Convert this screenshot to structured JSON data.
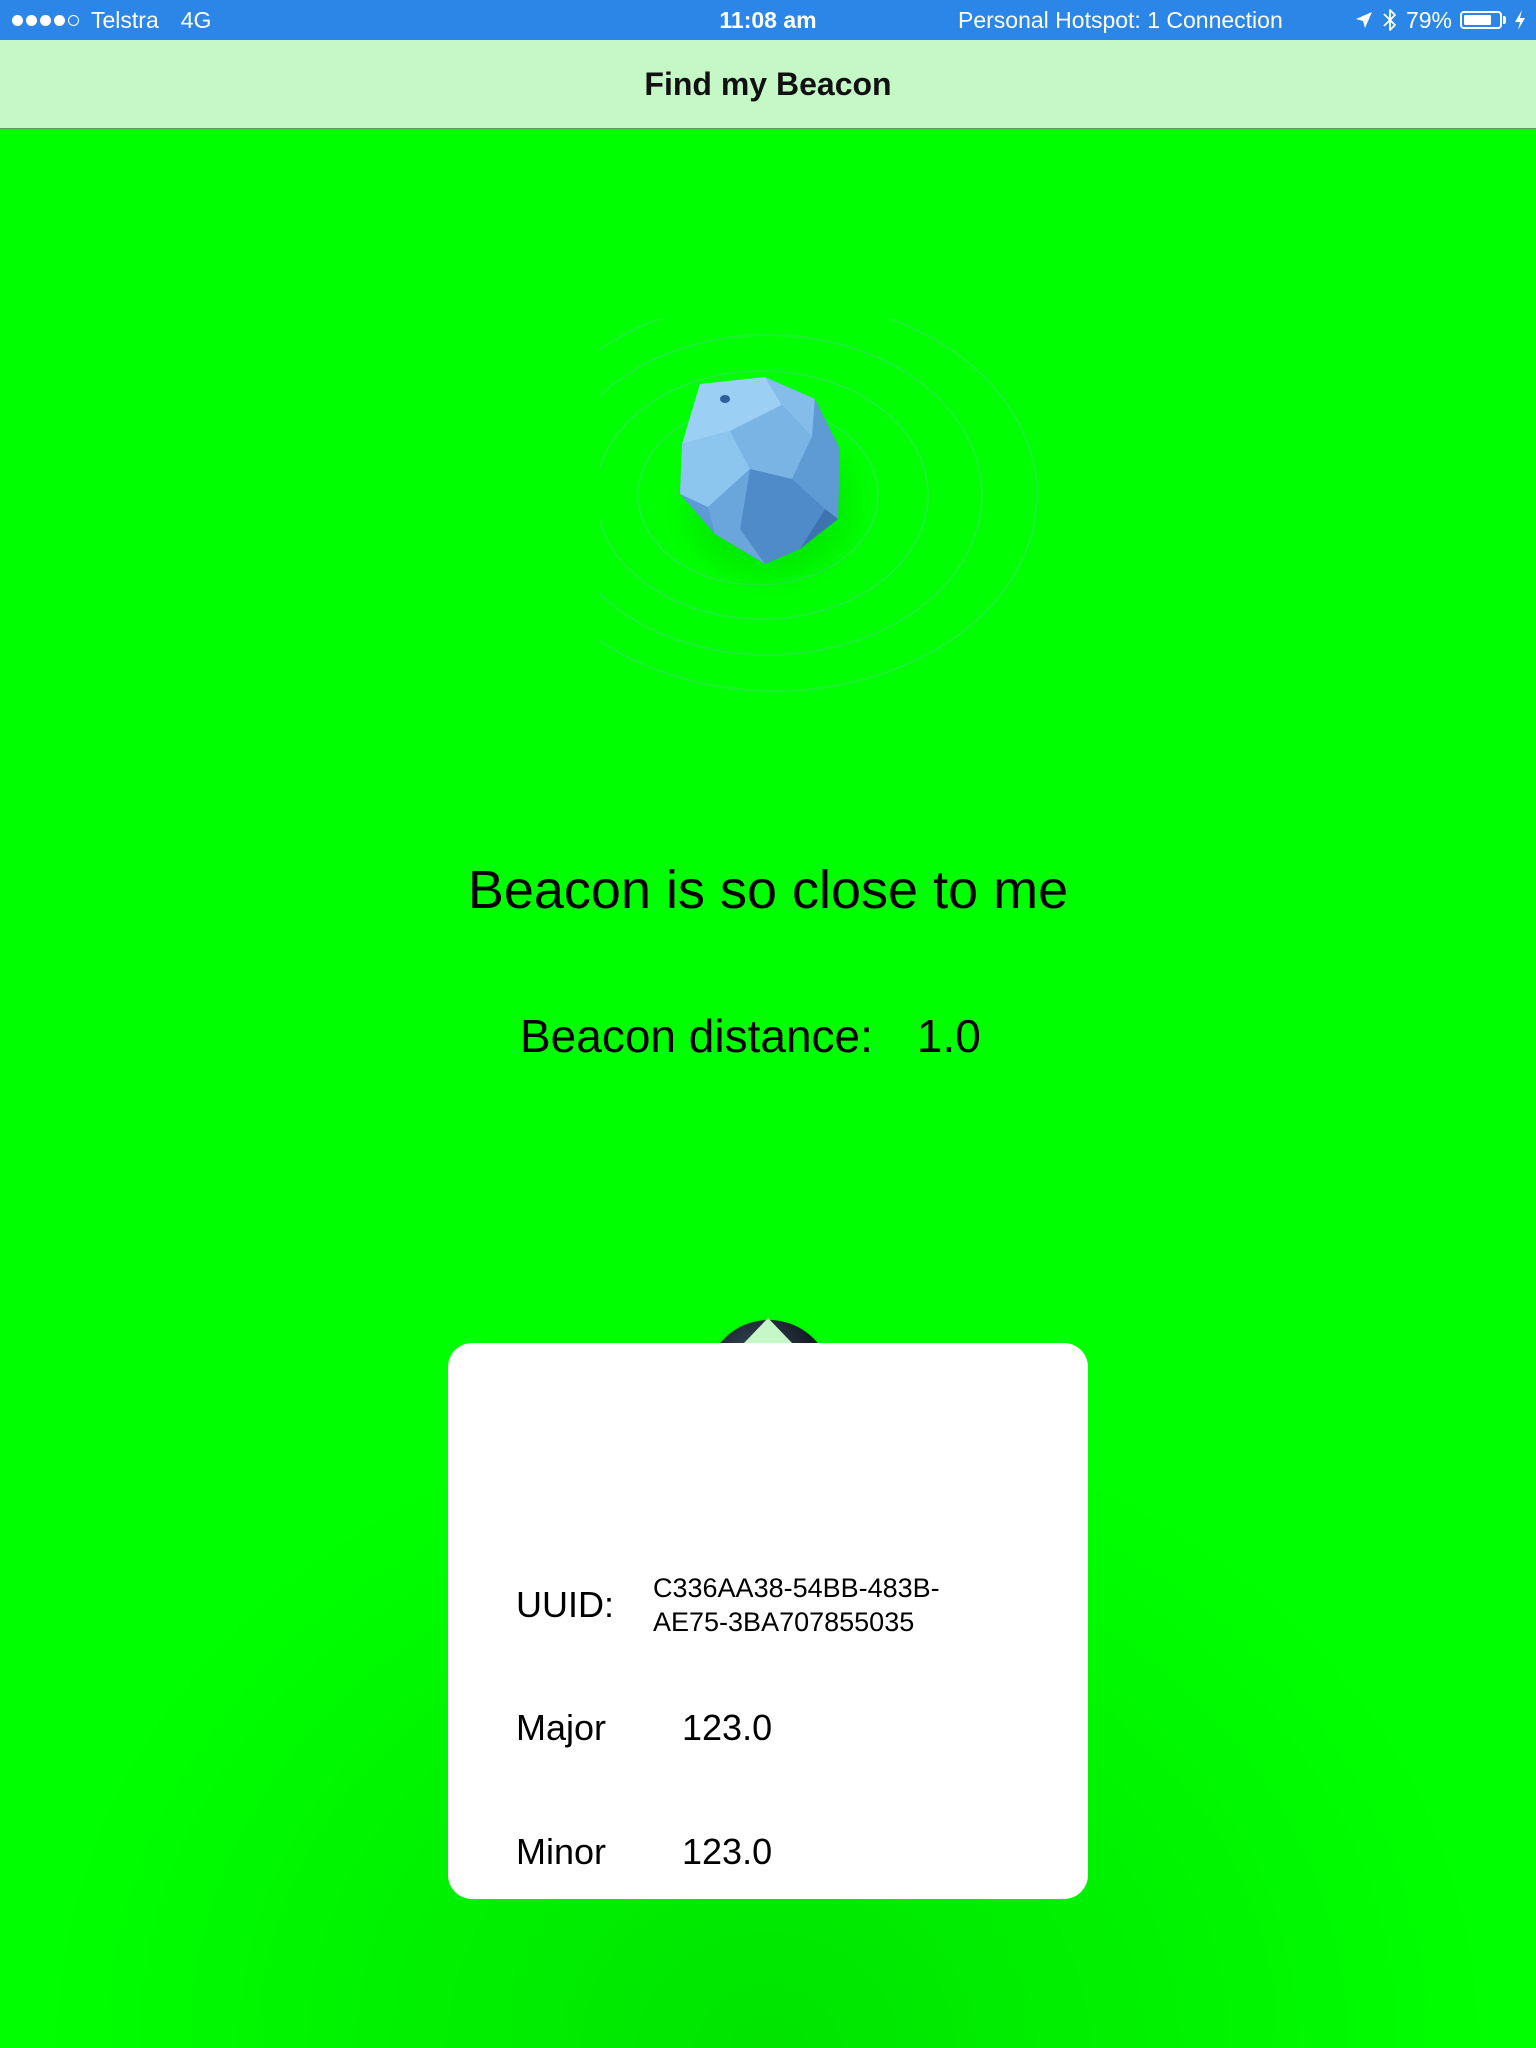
{
  "status_bar": {
    "carrier": "Telstra",
    "network": "4G",
    "time": "11:08 am",
    "hotspot": "Personal Hotspot: 1 Connection",
    "battery": "79%",
    "battery_level": 0.79,
    "signal_bars_filled": 4,
    "signal_bars_total": 5,
    "icons": [
      "location-arrow-icon",
      "bluetooth-icon",
      "battery-icon",
      "charging-bolt-icon"
    ]
  },
  "nav": {
    "title": "Find my Beacon"
  },
  "main": {
    "message": "Beacon is so close to me",
    "distance_label": "Beacon distance:",
    "distance_value": "1.0",
    "beacon_icon": "beacon-stone-icon",
    "info_icon": "info-icon"
  },
  "popover": {
    "uuid_label": "UUID:",
    "uuid_value": "C336AA38-54BB-483B-AE75-3BA707855035",
    "uuid_line1": "C336AA38-54BB-483B-",
    "uuid_line2": "AE75-3BA707855035",
    "major_label": "Major",
    "major_value": "123.0",
    "minor_label": "Minor",
    "minor_value": "123.0"
  },
  "colors": {
    "status_bar": "#2b86e8",
    "nav_bar": "#c6f7c6",
    "background": "#00ff00",
    "popover": "#ffffff"
  }
}
